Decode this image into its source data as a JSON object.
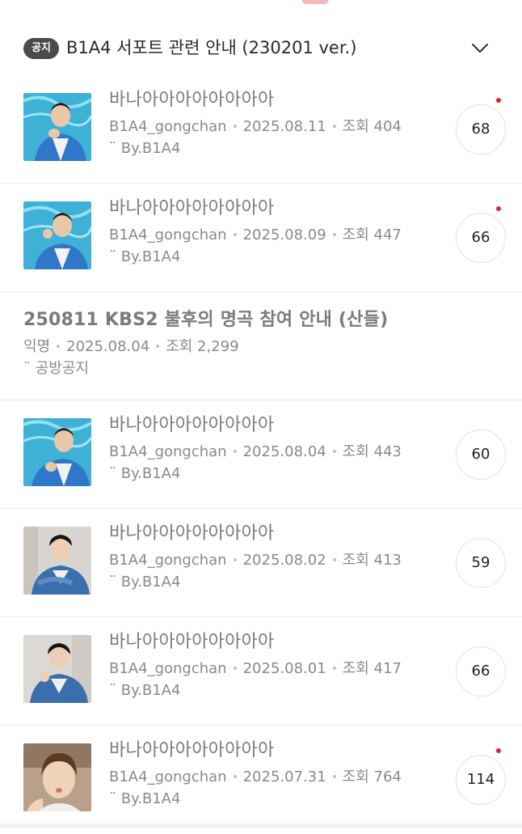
{
  "notice": {
    "badge": "공지",
    "title": "B1A4 서포트 관련 안내 (230201 ver.)"
  },
  "posts": [
    {
      "title": "바나아아아아아아아아",
      "author": "B1A4_gongchan",
      "date": "2025.08.11",
      "views": "조회 404",
      "tag": "¨ By.B1A4",
      "comments": "68",
      "has_new": true,
      "thumb_bg": "pool"
    },
    {
      "title": "바나아아아아아아아아",
      "author": "B1A4_gongchan",
      "date": "2025.08.09",
      "views": "조회 447",
      "tag": "¨ By.B1A4",
      "comments": "66",
      "has_new": true,
      "thumb_bg": "pool"
    },
    {
      "title": "250811 KBS2 불후의 명곡 참여 안내 (산들)",
      "author": "익명",
      "date": "2025.08.04",
      "views": "조회 2,299",
      "tag": "¨ 공방공지",
      "text_only": true
    },
    {
      "title": "바나아아아아아아아아",
      "author": "B1A4_gongchan",
      "date": "2025.08.04",
      "views": "조회 443",
      "tag": "¨ By.B1A4",
      "comments": "60",
      "has_new": false,
      "thumb_bg": "pool"
    },
    {
      "title": "바나아아아아아아아아",
      "author": "B1A4_gongchan",
      "date": "2025.08.02",
      "views": "조회 413",
      "tag": "¨ By.B1A4",
      "comments": "59",
      "has_new": false,
      "thumb_bg": "room"
    },
    {
      "title": "바나아아아아아아아아",
      "author": "B1A4_gongchan",
      "date": "2025.08.01",
      "views": "조회 417",
      "tag": "¨ By.B1A4",
      "comments": "66",
      "has_new": false,
      "thumb_bg": "room"
    },
    {
      "title": "바나아아아아아아아아",
      "author": "B1A4_gongchan",
      "date": "2025.07.31",
      "views": "조회 764",
      "tag": "¨ By.B1A4",
      "comments": "114",
      "has_new": true,
      "thumb_bg": "selfie"
    }
  ],
  "colors": {
    "badge_bg": "#4b4b4b",
    "new_dot": "#e0242c",
    "pool_blue": "#3fb1d6",
    "jacket_blue": "#2f77c8"
  },
  "icons": {
    "notice_toggle": "chevron-down-icon"
  }
}
